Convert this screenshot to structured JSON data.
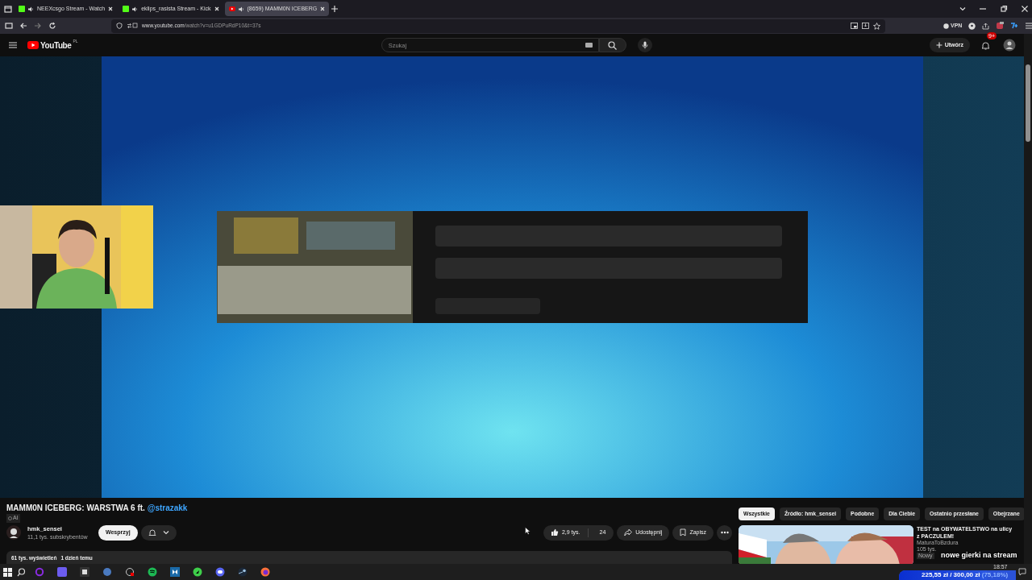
{
  "browser": {
    "tabs": [
      {
        "title": "NEEXcsgo Stream - Watch",
        "kind": "kick",
        "selected": false
      },
      {
        "title": "eklips_rasista Stream - Kick",
        "kind": "kick",
        "selected": false
      },
      {
        "title": "(8659) MAMM0N ICEBERG",
        "kind": "youtube",
        "selected": true
      }
    ],
    "url_host": "www.youtube.com",
    "url_path": "/watch?v=u1GDPuRdP10&t=37s",
    "vpn_label": "VPN"
  },
  "youtube": {
    "logo_text": "YouTube",
    "region": "PL",
    "search": {
      "placeholder": "Szukaj"
    },
    "create_label": "Utwórz",
    "notification_count": "9+"
  },
  "details": {
    "title": "MAMM0N ICEBERG: WARSTWA 6 ft.",
    "mention": "@strazakk",
    "ai_label": "AI",
    "channel": "hmk_sensei",
    "subscribers": "11,1 tys. subskrybentów",
    "support_label": "Wesprzyj",
    "likes": "2,9 tys.",
    "dislikes": "24",
    "share_label": "Udostępnij",
    "save_label": "Zapisz",
    "views": "61 tys. wyświetleń",
    "age": "1 dzień temu"
  },
  "chips": [
    {
      "label": "Wszystkie",
      "selected": true
    },
    {
      "label": "Źródło: hmk_sensei",
      "selected": false
    },
    {
      "label": "Podobne",
      "selected": false
    },
    {
      "label": "Dla Ciebie",
      "selected": false
    },
    {
      "label": "Ostatnio przesłane",
      "selected": false
    },
    {
      "label": "Obejrzane",
      "selected": false
    }
  ],
  "recommended": [
    {
      "title": "TEST na OBYWATELSTWO na ulicy z PACZULEM!",
      "channel": "MaturaToBzdura",
      "meta": "105 tys.",
      "badge": "Nowy"
    }
  ],
  "stream_overlay": {
    "caption": "nowe gierki na stream",
    "goal": {
      "amount": "225,55 zł / 300,00 zł",
      "percent": "(75,18%)",
      "level": 0.7518
    }
  },
  "taskbar": {
    "clock": "18:57"
  }
}
